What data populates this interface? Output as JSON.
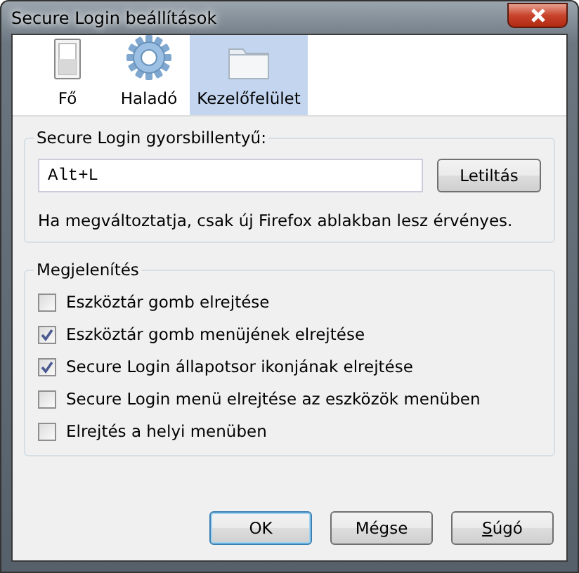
{
  "window": {
    "title": "Secure Login beállítások"
  },
  "tabs": [
    {
      "label": "Fő",
      "kind": "switch",
      "selected": false
    },
    {
      "label": "Haladó",
      "kind": "gear",
      "selected": false
    },
    {
      "label": "Kezelőfelület",
      "kind": "folder",
      "selected": true
    }
  ],
  "shortcut": {
    "legend": "Secure Login gyorsbillentyű:",
    "value": "Alt+L",
    "button": "Letiltás",
    "note": "Ha megváltoztatja, csak új Firefox ablakban lesz érvényes."
  },
  "display": {
    "legend": "Megjelenítés",
    "options": [
      {
        "label": "Eszköztár gomb elrejtése",
        "checked": false
      },
      {
        "label": "Eszköztár gomb menüjének elrejtése",
        "checked": true
      },
      {
        "label": "Secure Login állapotsor ikonjának elrejtése",
        "checked": true
      },
      {
        "label": "Secure Login menü elrejtése az eszközök menüben",
        "checked": false
      },
      {
        "label": "Elrejtés a helyi menüben",
        "checked": false
      }
    ]
  },
  "buttons": [
    {
      "label": "OK",
      "default": true,
      "accesskey_first": false
    },
    {
      "label": "Mégse",
      "default": false,
      "accesskey_first": false
    },
    {
      "label": "Súgó",
      "default": false,
      "accesskey_first": true
    }
  ]
}
